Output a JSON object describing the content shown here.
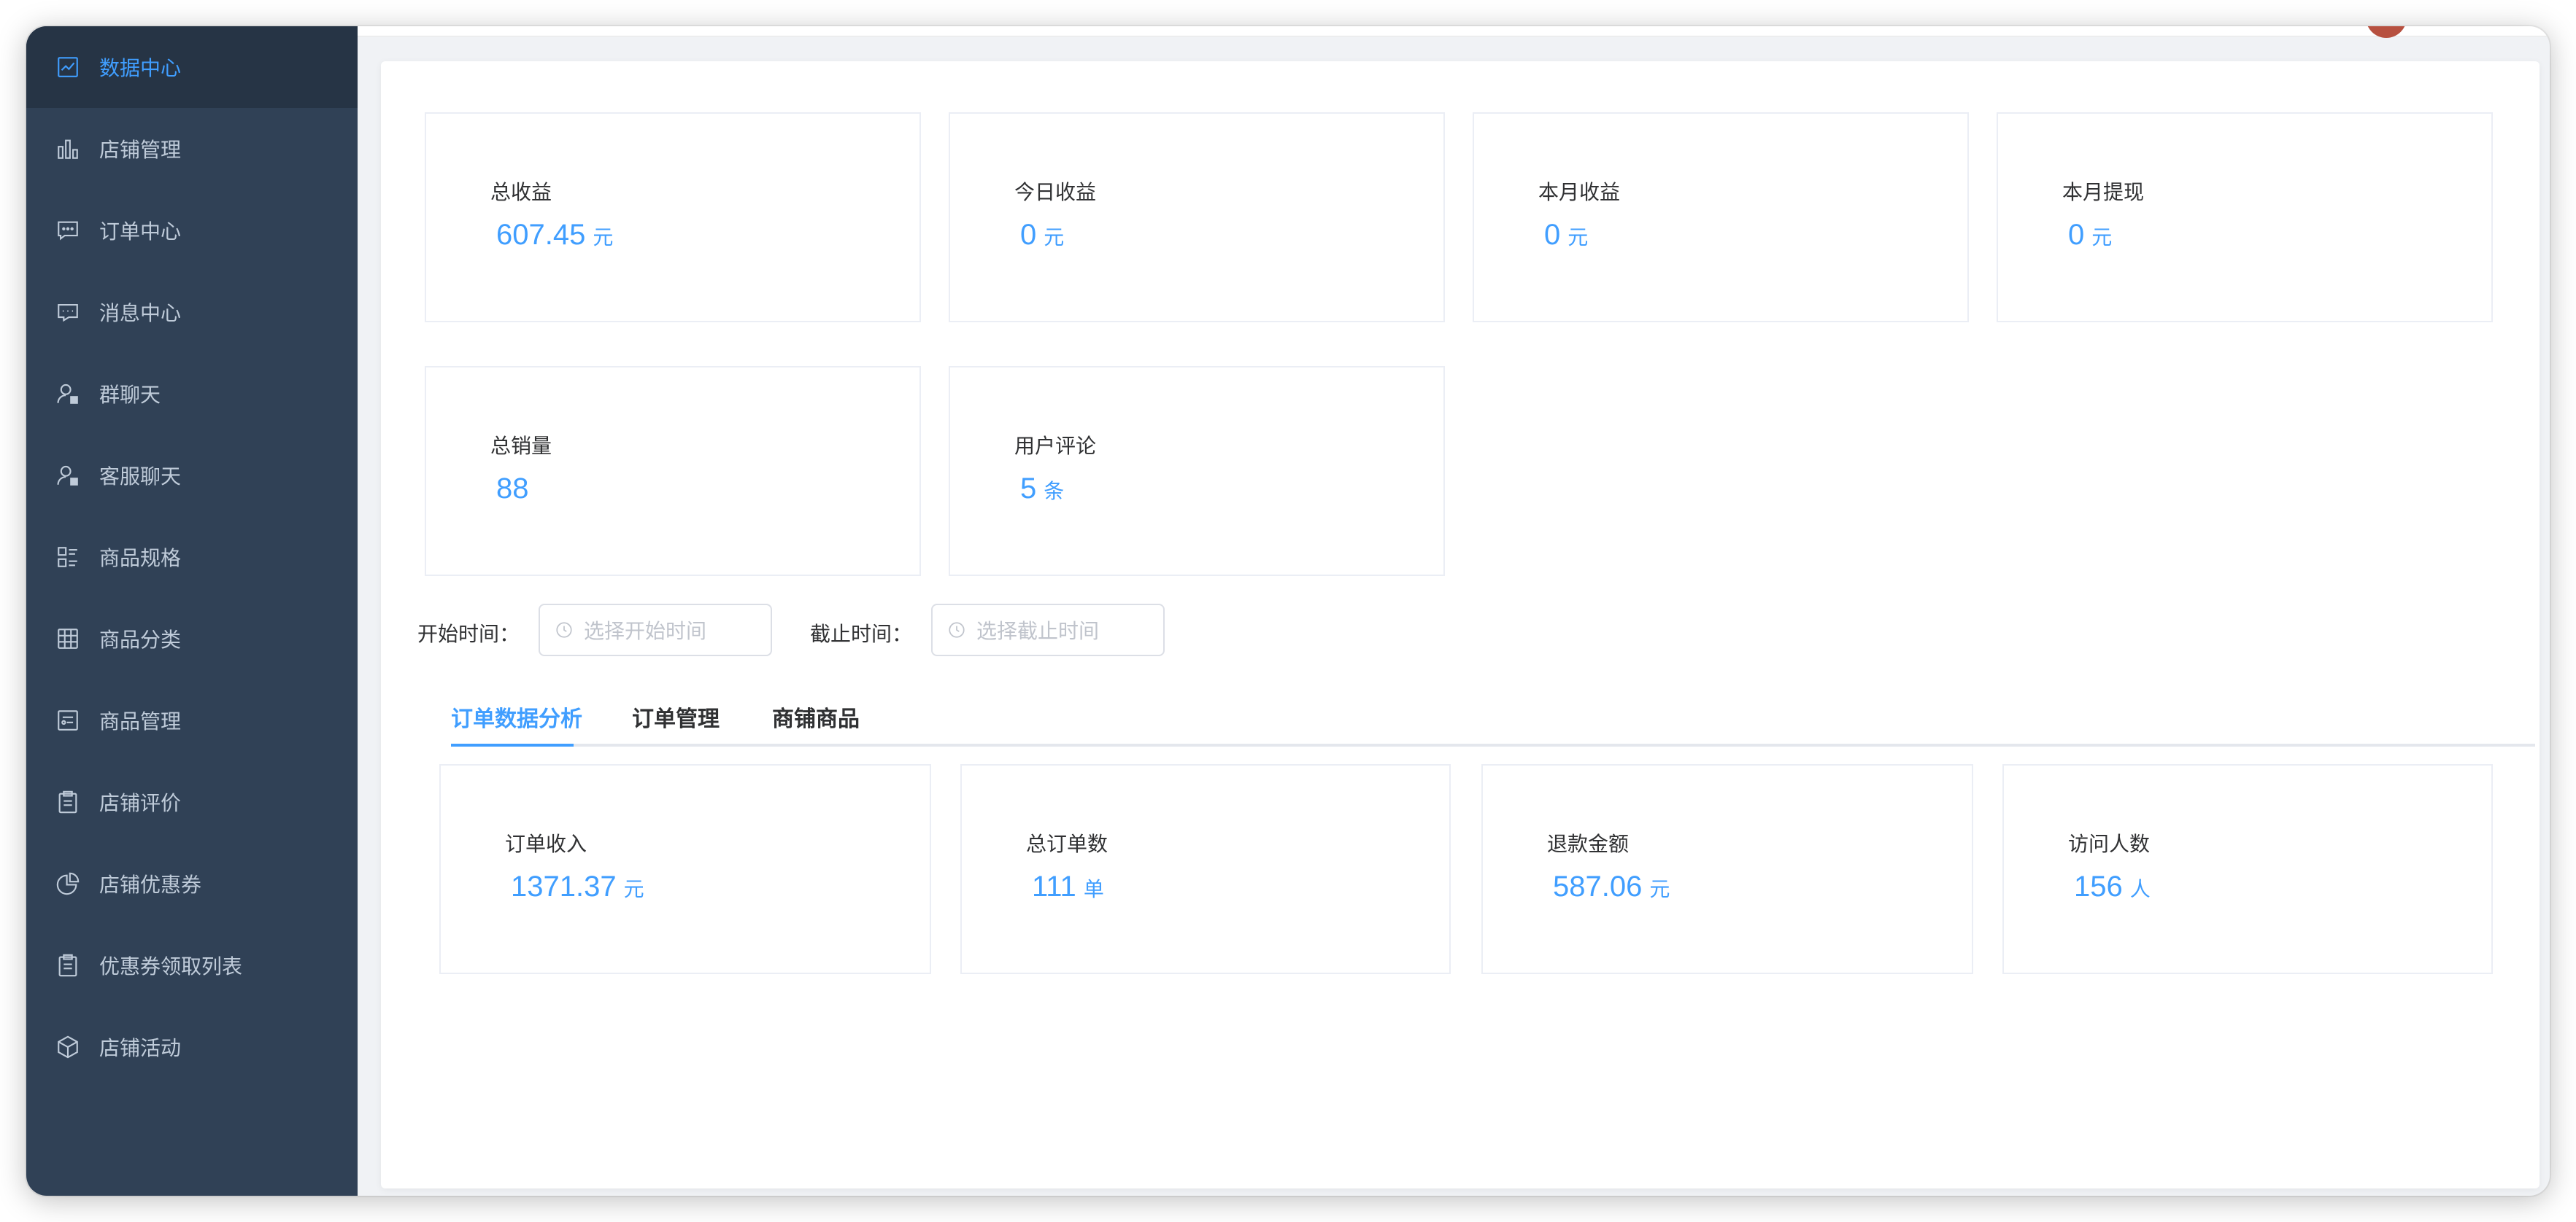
{
  "sidebar": {
    "items": [
      {
        "label": "数据中心",
        "icon": "chart-line-icon"
      },
      {
        "label": "店铺管理",
        "icon": "bar-chart-icon"
      },
      {
        "label": "订单中心",
        "icon": "chat-bubble-icon"
      },
      {
        "label": "消息中心",
        "icon": "message-icon"
      },
      {
        "label": "群聊天",
        "icon": "user-icon"
      },
      {
        "label": "客服聊天",
        "icon": "user-icon"
      },
      {
        "label": "商品规格",
        "icon": "list-icon"
      },
      {
        "label": "商品分类",
        "icon": "grid-icon"
      },
      {
        "label": "商品管理",
        "icon": "card-icon"
      },
      {
        "label": "店铺评价",
        "icon": "clipboard-icon"
      },
      {
        "label": "店铺优惠券",
        "icon": "pie-chart-icon"
      },
      {
        "label": "优惠券领取列表",
        "icon": "clipboard-icon"
      },
      {
        "label": "店铺活动",
        "icon": "box-icon"
      }
    ]
  },
  "stats": [
    {
      "title": "总收益",
      "value": "607.45",
      "unit": "元"
    },
    {
      "title": "今日收益",
      "value": "0",
      "unit": "元"
    },
    {
      "title": "本月收益",
      "value": "0",
      "unit": "元"
    },
    {
      "title": "本月提现",
      "value": "0",
      "unit": "元"
    },
    {
      "title": "总销量",
      "value": "88",
      "unit": ""
    },
    {
      "title": "用户评论",
      "value": "5",
      "unit": "条"
    }
  ],
  "filters": {
    "start_label": "开始时间：",
    "start_placeholder": "选择开始时间",
    "end_label": "截止时间：",
    "end_placeholder": "选择截止时间"
  },
  "tabs": [
    "订单数据分析",
    "订单管理",
    "商铺商品"
  ],
  "order_stats": [
    {
      "title": "订单收入",
      "value": "1371.37",
      "unit": "元"
    },
    {
      "title": "总订单数",
      "value": "111",
      "unit": "单"
    },
    {
      "title": "退款金额",
      "value": "587.06",
      "unit": "元"
    },
    {
      "title": "访问人数",
      "value": "156",
      "unit": "人"
    }
  ],
  "colors": {
    "accent": "#409eff",
    "sidebar_bg": "#304156",
    "sidebar_active_bg": "#263445"
  }
}
